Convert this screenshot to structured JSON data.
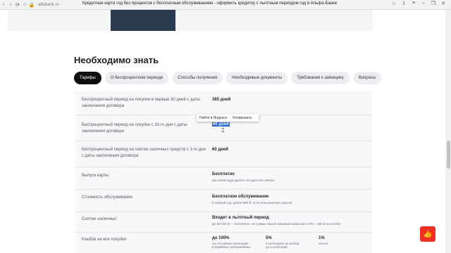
{
  "browser": {
    "domain": "alfabank.ru",
    "tab_title": "Кредитная карта год без процентов с бесплатным обслуживанием - оформить кредитку с льготным периодом год в Альфа-Банке"
  },
  "section": {
    "title": "Необходимо знать"
  },
  "tabs": [
    {
      "label": "Тарифы"
    },
    {
      "label": "О беспроцентном периоде"
    },
    {
      "label": "Способы получения"
    },
    {
      "label": "Необходимые документы"
    },
    {
      "label": "Требования к заёмщику"
    },
    {
      "label": "Вопросы"
    }
  ],
  "rows": [
    {
      "label": "Беспроцентный период на покупки в первые 30 дней с даты заключения договора",
      "value": "365 дней",
      "sub": ""
    },
    {
      "label": "Беспроцентный период на покупки с 31-го дня с даты заключения договора",
      "value": "60 дней",
      "sub": ""
    },
    {
      "label": "Беспроцентный период на снятие наличных средств с 1-го дня с даты заключения договора",
      "value": "60 дней",
      "sub": ""
    },
    {
      "label": "Выпуск карты",
      "value": "Бесплатно",
      "sub": "доставим куда удобно сегодня или завтра"
    },
    {
      "label": "Стоимость обслуживания",
      "value": "Бесплатное обслуживание",
      "sub": "в первый год, далее 990 ₽, если пользовались картой"
    },
    {
      "label": "Снятие наличных",
      "value": "Входит в льготный период",
      "sub": "До 50 000 ₽ — бесплатно, на суммы свыше взимаем комиссию 3,9% + 390 ₽ за снятие"
    }
  ],
  "cashback": {
    "label": "Кэшбэк на все покупки",
    "cols": [
      {
        "value": "до 100%",
        "sub1": "на случайную категорию",
        "sub2": "в барабане суперкэшбэка"
      },
      {
        "value": "5%",
        "sub1": "в категориях на выбор",
        "sub2": "до 5 категорий"
      },
      {
        "value": "1%",
        "sub1": "на всё",
        "sub2": ""
      }
    ]
  },
  "context_menu": {
    "items": [
      "Найти в Яндексе",
      "Копировать",
      "⋮"
    ]
  },
  "colors": {
    "accent": "#ef3124",
    "active_tab": "#0e0e10",
    "selection": "#1d62d3"
  },
  "fab_icon": "thumb-up-icon"
}
